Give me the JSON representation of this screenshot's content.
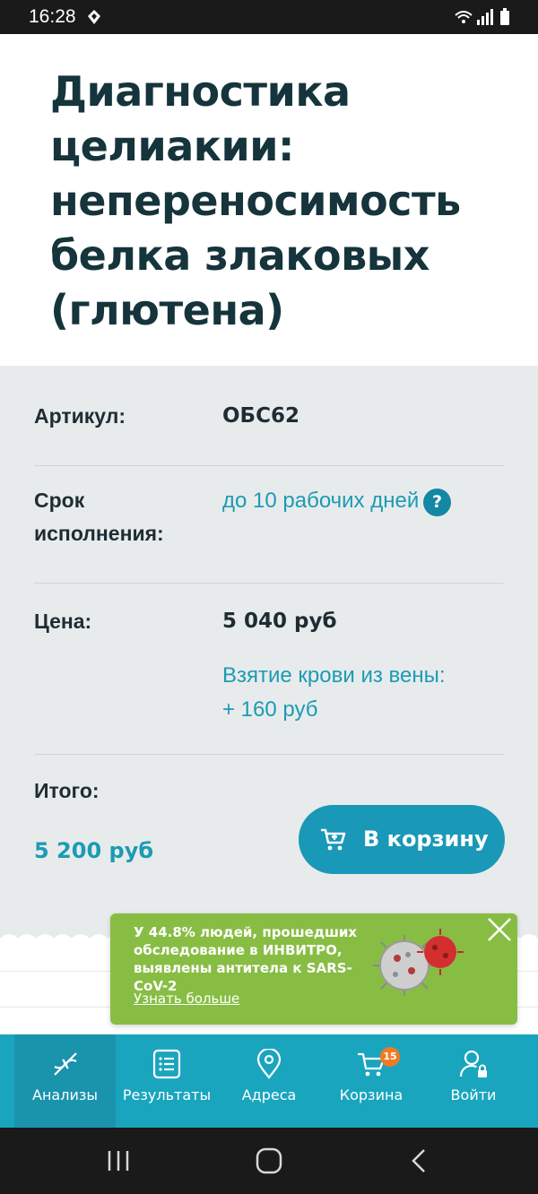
{
  "status_bar": {
    "time": "16:28"
  },
  "title": "Диагностика целиакии: непереносимость белка злаковых (глютена)",
  "details": {
    "article_label": "Артикул:",
    "article_value": "ОБС62",
    "term_label": "Срок исполнения:",
    "term_value": "до 10 рабочих дней",
    "help": "?",
    "price_label": "Цена:",
    "price_value": "5 040 руб",
    "blood_draw_line1": "Взятие крови из вены:",
    "blood_draw_line2": "+ 160 руб",
    "total_label": "Итого:",
    "total_value": "5 200 руб",
    "cart_button": "В корзину"
  },
  "promo": {
    "text": "У 44.8% людей, прошедших обследование в ИНВИТРО, выявлены антитела к SARS-CoV-2",
    "link": "Узнать больше"
  },
  "tabs": [
    {
      "label": "Анализы",
      "icon": "dna-icon",
      "active": true
    },
    {
      "label": "Результаты",
      "icon": "list-icon"
    },
    {
      "label": "Адреса",
      "icon": "location-pin-icon"
    },
    {
      "label": "Корзина",
      "icon": "cart-icon",
      "badge": "15"
    },
    {
      "label": "Войти",
      "icon": "user-lock-icon"
    }
  ],
  "colors": {
    "accent": "#1a98b7",
    "tabbar": "#1aa5be",
    "title": "#15343b",
    "promo": "#88bd44",
    "badge": "#f27a22"
  }
}
